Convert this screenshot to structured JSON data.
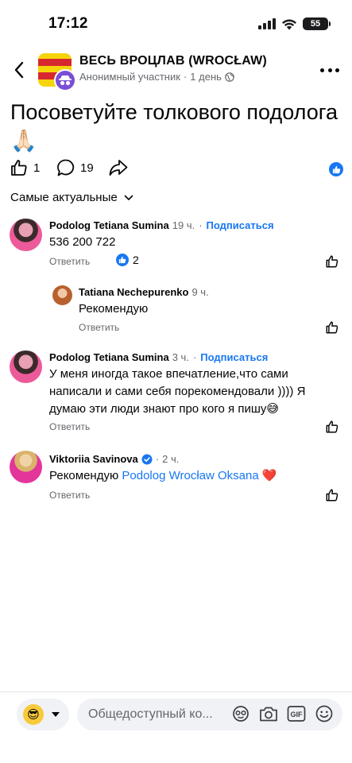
{
  "status_bar": {
    "time": "17:12",
    "battery": "55"
  },
  "header": {
    "group_name": "ВЕСЬ ВРОЦЛАВ (WROCŁAW)",
    "author": "Анонимный участник",
    "separator": "·",
    "time": "1 день"
  },
  "post": {
    "title": "Посоветуйте толкового подолога 🙏🏻",
    "like_count": "1",
    "comment_count": "19"
  },
  "sort": {
    "label": "Самые актуальные"
  },
  "comments": [
    {
      "name": "Podolog Tetiana Sumina",
      "time": "19 ч.",
      "dot": "·",
      "follow": "Подписаться",
      "text": "536 200 722",
      "reply": "Ответить",
      "reaction_count": "2"
    },
    {
      "name": "Tatiana Nechepurenko",
      "time": "9 ч.",
      "text": "Рекомендую",
      "reply": "Ответить"
    },
    {
      "name": "Podolog Tetiana Sumina",
      "time": "3 ч.",
      "dot": "·",
      "follow": "Подписаться",
      "text": "У меня иногда такое впечатление,что сами написали и сами себя порекомендовали )))) Я думаю эти люди знают про кого я пишу😅",
      "reply": "Ответить"
    },
    {
      "name": "Viktoriia Savinova",
      "time": "2 ч.",
      "text_prefix": "Рекомендую ",
      "mention": "Podolog Wrocław Oksana",
      "text_suffix": " ❤️",
      "reply": "Ответить"
    }
  ],
  "composer": {
    "placeholder": "Общедоступный ко...",
    "profile_emoji": "😎",
    "gif_label": "GIF"
  },
  "colors": {
    "accent": "#1877f2",
    "secondary_text": "#65676b",
    "primary_text": "#050505"
  }
}
